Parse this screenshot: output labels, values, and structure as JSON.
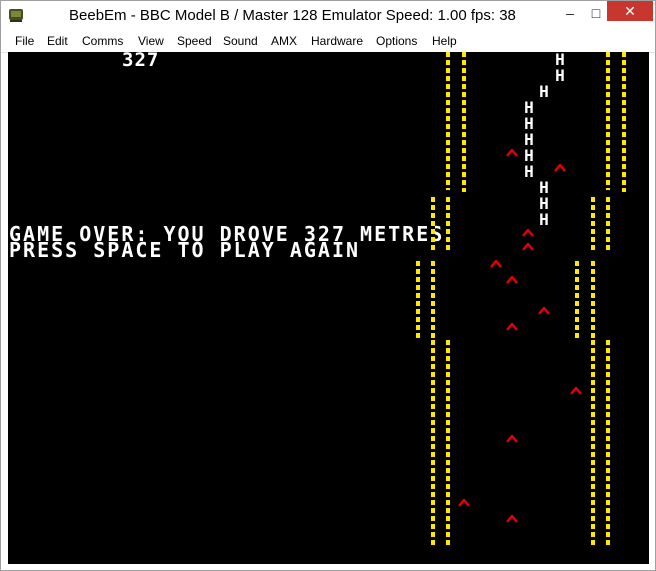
{
  "window": {
    "title": "BeebEm - BBC Model B / Master 128 Emulator  Speed: 1.00  fps: 38",
    "minimize_icon": "minimize-icon",
    "maximize_icon": "maximize-icon",
    "close_icon": "close-icon"
  },
  "menu": {
    "items": [
      "File",
      "Edit",
      "Comms",
      "View",
      "Speed",
      "Sound",
      "AMX",
      "Hardware",
      "Options",
      "Help"
    ]
  },
  "game": {
    "score": "327",
    "message_line1": "GAME OVER: YOU DROVE 327 METRES",
    "message_line2": "PRESS SPACE TO PLAY AGAIN",
    "player_char": "H",
    "colors": {
      "background": "#000000",
      "road_edge": "#ffe800",
      "obstacle": "#e00000",
      "text": "#ffffff"
    }
  }
}
